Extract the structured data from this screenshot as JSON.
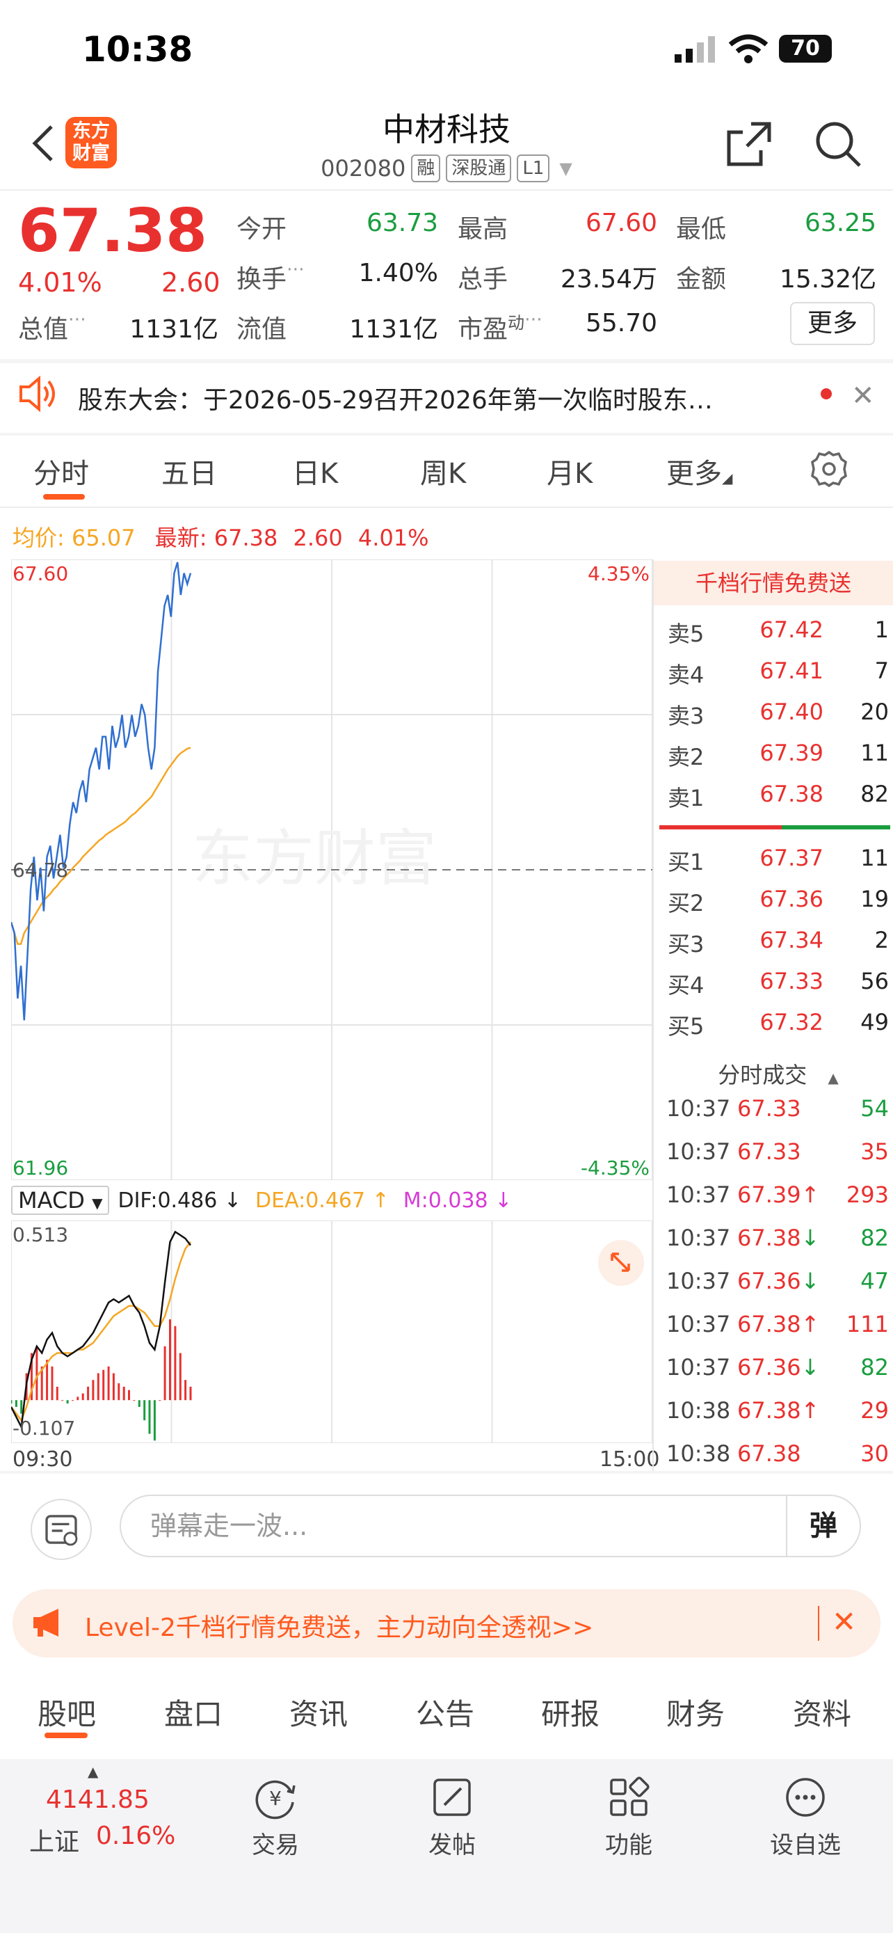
{
  "status_bar": {
    "time": "10:38",
    "battery": "70"
  },
  "header": {
    "logo_line1": "东方",
    "logo_line2": "财富",
    "name": "中材科技",
    "code": "002080",
    "tags": [
      "融",
      "深股通",
      "L1"
    ]
  },
  "quote": {
    "price": "67.38",
    "change_pct": "4.01%",
    "change_val": "2.60",
    "fields": [
      {
        "label": "今开",
        "value": "63.73",
        "color": "green"
      },
      {
        "label": "最高",
        "value": "67.60",
        "color": "red"
      },
      {
        "label": "最低",
        "value": "63.25",
        "color": "green"
      },
      {
        "label": "换手",
        "value": "1.40%",
        "color": "black"
      },
      {
        "label": "总手",
        "value": "23.54万",
        "color": "black"
      },
      {
        "label": "金额",
        "value": "15.32亿",
        "color": "black"
      },
      {
        "label": "总值",
        "value": "1131亿",
        "color": "black"
      },
      {
        "label": "流值",
        "value": "1131亿",
        "color": "black"
      },
      {
        "label": "市盈",
        "value": "55.70",
        "color": "black"
      }
    ],
    "pe_sup": "动",
    "more_label": "更多"
  },
  "notice": {
    "text": "股东大会：于2026-05-29召开2026年第一次临时股东…",
    "close": "✕"
  },
  "chart_tabs": [
    "分时",
    "五日",
    "日K",
    "周K",
    "月K",
    "更多"
  ],
  "price_line": {
    "avg_label": "均价:",
    "avg_value": "65.07",
    "latest_label": "最新:",
    "latest_value": "67.38",
    "change": "2.60",
    "pct": "4.01%"
  },
  "chart_data": [
    {
      "type": "line",
      "y_top_label": "67.60",
      "y_bottom_label": "61.96",
      "y_mid_label": "64.78",
      "pct_top_label": "4.35%",
      "pct_bottom_label": "-4.35%",
      "watermark": "东方财富",
      "ylim": [
        61.96,
        67.6
      ],
      "prev_close": 64.78,
      "series": [
        {
          "values": [
            64.3,
            64.2,
            63.6,
            63.9,
            63.4,
            64.0,
            64.6,
            64.9,
            64.5,
            64.8,
            64.4,
            64.9,
            65.0,
            64.7,
            64.9,
            65.1,
            64.8,
            64.9,
            65.2,
            65.4,
            65.3,
            65.5,
            65.6,
            65.4,
            65.7,
            65.8,
            65.9,
            65.7,
            66.0,
            66.0,
            65.7,
            66.1,
            65.9,
            66.0,
            66.2,
            65.9,
            66.0,
            66.2,
            66.0,
            66.1,
            66.3,
            66.2,
            65.9,
            65.7,
            65.9,
            66.6,
            66.9,
            67.2,
            67.3,
            67.1,
            67.5,
            67.6,
            67.3,
            67.5,
            67.4,
            67.5
          ]
        },
        {
          "values": [
            64.3,
            64.2,
            64.1,
            64.1,
            64.2,
            64.25,
            64.3,
            64.35,
            64.4,
            64.45,
            64.5,
            64.53,
            64.56,
            64.6,
            64.63,
            64.67,
            64.7,
            64.73,
            64.76,
            64.8,
            64.83,
            64.86,
            64.9,
            64.93,
            64.96,
            64.99,
            65.02,
            65.05,
            65.07,
            65.1,
            65.12,
            65.14,
            65.16,
            65.18,
            65.2,
            65.22,
            65.25,
            65.28,
            65.3,
            65.33,
            65.36,
            65.39,
            65.42,
            65.45,
            65.5,
            65.55,
            65.6,
            65.65,
            65.7,
            65.74,
            65.78,
            65.82,
            65.85,
            65.87,
            65.89,
            65.9
          ]
        }
      ]
    },
    {
      "type": "bar",
      "indicator": "MACD",
      "dif_label": "DIF:0.486 ↓",
      "dea_label": "DEA:0.467 ↑",
      "m_label": "M:0.038 ↓",
      "y_top_label": "0.513",
      "y_bottom_label": "-0.107",
      "ylim": [
        -0.107,
        0.513
      ],
      "series": [
        {
          "values": [
            -0.02,
            -0.05,
            -0.08,
            0.05,
            0.12,
            0.16,
            0.14,
            0.18,
            0.2,
            0.16,
            0.14,
            0.13,
            0.14,
            0.15,
            0.16,
            0.18,
            0.2,
            0.23,
            0.26,
            0.29,
            0.3,
            0.29,
            0.3,
            0.31,
            0.28,
            0.26,
            0.22,
            0.17,
            0.15,
            0.22,
            0.35,
            0.47,
            0.5,
            0.49,
            0.48,
            0.46
          ]
        },
        {
          "values": [
            -0.02,
            -0.04,
            -0.06,
            -0.02,
            0.03,
            0.07,
            0.09,
            0.11,
            0.13,
            0.14,
            0.14,
            0.14,
            0.14,
            0.15,
            0.15,
            0.16,
            0.17,
            0.19,
            0.21,
            0.23,
            0.25,
            0.26,
            0.27,
            0.28,
            0.28,
            0.27,
            0.26,
            0.24,
            0.22,
            0.22,
            0.25,
            0.3,
            0.36,
            0.41,
            0.45,
            0.47
          ]
        },
        {
          "values": [
            -0.01,
            -0.02,
            -0.04,
            0.08,
            0.14,
            0.16,
            0.1,
            0.12,
            0.1,
            0.04,
            0.0,
            -0.01,
            0.0,
            0.01,
            0.02,
            0.04,
            0.06,
            0.08,
            0.09,
            0.1,
            0.08,
            0.05,
            0.04,
            0.03,
            0.0,
            -0.02,
            -0.06,
            -0.1,
            -0.12,
            0.0,
            0.16,
            0.24,
            0.22,
            0.14,
            0.06,
            0.04
          ]
        }
      ]
    }
  ],
  "time_axis": {
    "start": "09:30",
    "end": "15:00"
  },
  "order_book": {
    "header": "千档行情免费送",
    "asks": [
      {
        "label": "卖5",
        "price": "67.42",
        "vol": "1"
      },
      {
        "label": "卖4",
        "price": "67.41",
        "vol": "7"
      },
      {
        "label": "卖3",
        "price": "67.40",
        "vol": "20"
      },
      {
        "label": "卖2",
        "price": "67.39",
        "vol": "11"
      },
      {
        "label": "卖1",
        "price": "67.38",
        "vol": "82"
      }
    ],
    "bids": [
      {
        "label": "买1",
        "price": "67.37",
        "vol": "11"
      },
      {
        "label": "买2",
        "price": "67.36",
        "vol": "19"
      },
      {
        "label": "买3",
        "price": "67.34",
        "vol": "2"
      },
      {
        "label": "买4",
        "price": "67.33",
        "vol": "56"
      },
      {
        "label": "买5",
        "price": "67.32",
        "vol": "49"
      }
    ],
    "trades_title": "分时成交",
    "trades": [
      {
        "time": "10:37",
        "price": "67.33",
        "vol": "54",
        "dir": "",
        "vol_color": "green"
      },
      {
        "time": "10:37",
        "price": "67.33",
        "vol": "35",
        "dir": "",
        "vol_color": "red"
      },
      {
        "time": "10:37",
        "price": "67.39",
        "vol": "293",
        "dir": "↑",
        "vol_color": "red"
      },
      {
        "time": "10:37",
        "price": "67.38",
        "vol": "82",
        "dir": "↓",
        "vol_color": "green"
      },
      {
        "time": "10:37",
        "price": "67.36",
        "vol": "47",
        "dir": "↓",
        "vol_color": "green"
      },
      {
        "time": "10:37",
        "price": "67.38",
        "vol": "111",
        "dir": "↑",
        "vol_color": "red"
      },
      {
        "time": "10:37",
        "price": "67.36",
        "vol": "82",
        "dir": "↓",
        "vol_color": "green"
      },
      {
        "time": "10:38",
        "price": "67.38",
        "vol": "29",
        "dir": "↑",
        "vol_color": "red"
      },
      {
        "time": "10:38",
        "price": "67.38",
        "vol": "30",
        "dir": "",
        "vol_color": "red"
      }
    ]
  },
  "comment": {
    "placeholder": "弹幕走一波...",
    "danmu_label": "弹"
  },
  "level2": {
    "text": "Level-2千档行情免费送，主力动向全透视>>",
    "close": "✕"
  },
  "section_tabs": [
    "股吧",
    "盘口",
    "资讯",
    "公告",
    "研报",
    "财务",
    "资料"
  ],
  "bottom_nav": {
    "index_value": "4141.85",
    "index_name": "上证",
    "index_pct": "0.16%",
    "items": [
      "交易",
      "发帖",
      "功能",
      "设自选"
    ]
  },
  "colors": {
    "up": "#e8312f",
    "down": "#1a9d3f",
    "accent": "#ff5a1f",
    "avg": "#f5a623",
    "price_line": "#2f6fd1"
  }
}
